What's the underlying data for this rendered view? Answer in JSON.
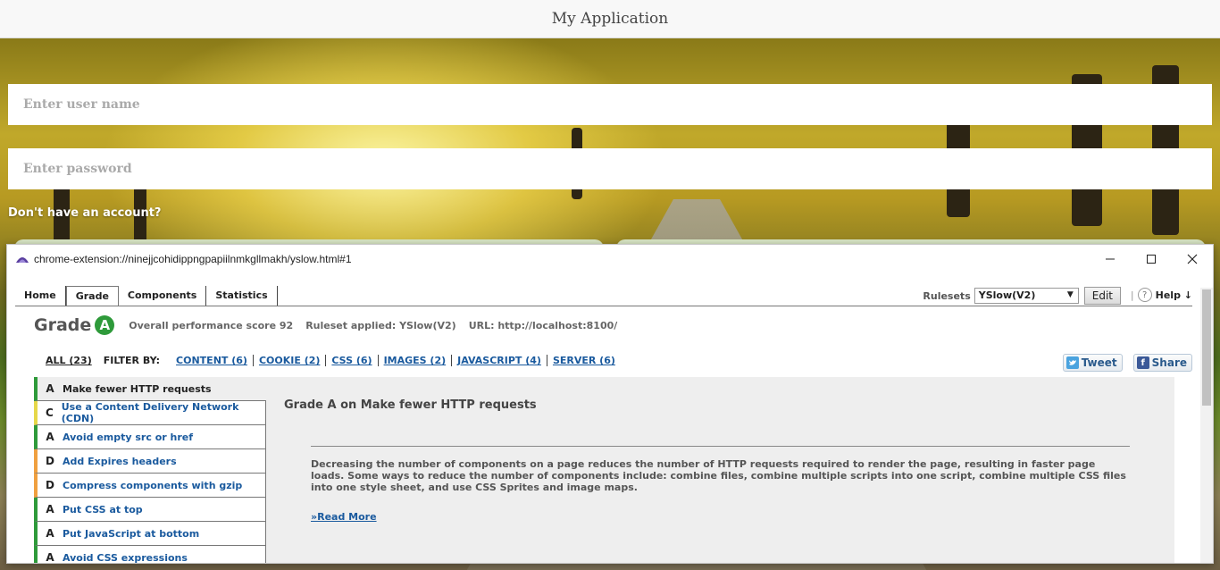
{
  "app": {
    "title": "My Application"
  },
  "login": {
    "username_placeholder": "Enter user name",
    "password_placeholder": "Enter password",
    "no_account": "Don't have an account?"
  },
  "window": {
    "url": "chrome-extension://ninejjcohidippngpapiilnmkgllmakh/yslow.html#1",
    "minimize_glyph": "─",
    "maximize_glyph": "☐",
    "close_glyph": "✕"
  },
  "yslow": {
    "tabs": [
      "Home",
      "Grade",
      "Components",
      "Statistics"
    ],
    "active_tab": "Grade",
    "rulesets_label": "Rulesets",
    "ruleset_value": "YSlow(V2)",
    "edit_label": "Edit",
    "help_label": "Help ↓",
    "help_icon_glyph": "?",
    "grade_word": "Grade",
    "grade_letter": "A",
    "score_text": "Overall performance score 92",
    "ruleset_applied": "Ruleset applied: YSlow(V2)",
    "url_text": "URL: http://localhost:8100/",
    "filter_all": "ALL (23)",
    "filter_by": "FILTER BY:",
    "filters": [
      "CONTENT (6)",
      "COOKIE (2)",
      "CSS (6)",
      "IMAGES (2)",
      "JAVASCRIPT (4)",
      "SERVER (6)"
    ],
    "tweet_label": "Tweet",
    "share_label": "Share",
    "rules": [
      {
        "grade": "A",
        "label": "Make fewer HTTP requests",
        "color": "#2e9a3a"
      },
      {
        "grade": "C",
        "label": "Use a Content Delivery Network (CDN)",
        "color": "#e6d84a"
      },
      {
        "grade": "A",
        "label": "Avoid empty src or href",
        "color": "#2e9a3a"
      },
      {
        "grade": "D",
        "label": "Add Expires headers",
        "color": "#f0a040"
      },
      {
        "grade": "D",
        "label": "Compress components with gzip",
        "color": "#f0a040"
      },
      {
        "grade": "A",
        "label": "Put CSS at top",
        "color": "#2e9a3a"
      },
      {
        "grade": "A",
        "label": "Put JavaScript at bottom",
        "color": "#2e9a3a"
      },
      {
        "grade": "A",
        "label": "Avoid CSS expressions",
        "color": "#2e9a3a"
      }
    ],
    "detail_title": "Grade A on Make fewer HTTP requests",
    "detail_text": "Decreasing the number of components on a page reduces the number of HTTP requests required to render the page, resulting in faster page loads. Some ways to reduce the number of components include: combine files, combine multiple scripts into one script, combine multiple CSS files into one style sheet, and use CSS Sprites and image maps.",
    "read_more": "»Read More"
  }
}
